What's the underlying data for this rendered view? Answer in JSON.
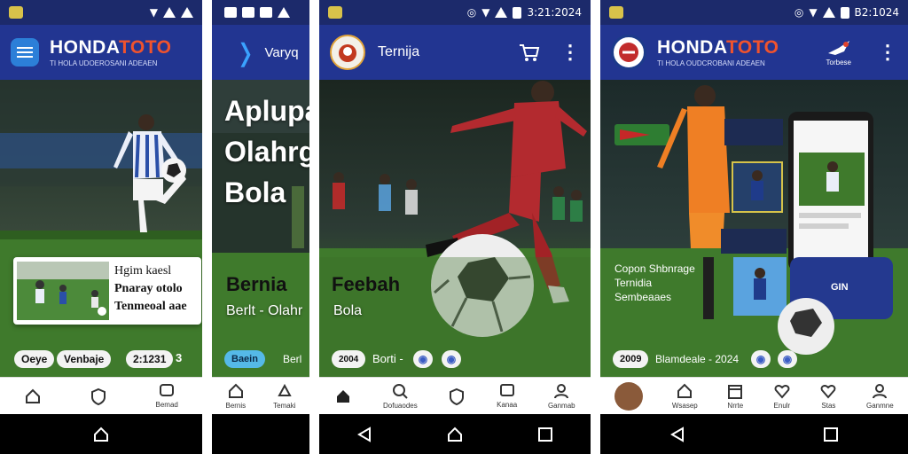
{
  "colors": {
    "appbar": "#223591",
    "statusbar": "#1c2a6b",
    "accent": "#f0532d",
    "pitch": "#3f7a2c"
  },
  "panel1": {
    "brand": "HONDATOTO",
    "brand_accent": "TOTO",
    "brand_main": "HONDA",
    "tagline": "TI HOLA UDOEROSANI ADEAEN",
    "card_lines": [
      "Hgim kaesl",
      "Pnaray otolo",
      "Tenmeoal aae"
    ],
    "chips": [
      "Oeye",
      "Venbaje",
      "2:1231",
      "3"
    ],
    "nav": [
      "",
      "",
      "Bemad"
    ],
    "nav_icons": [
      "home-icon",
      "shield-icon",
      "chat-icon"
    ]
  },
  "panel2": {
    "title": "Varyq",
    "hero_title_lines": [
      "Aplupasi Bernja",
      "Olahrgaga",
      "Bola"
    ],
    "mid_left": "Bernia",
    "mid_right": "Feebah",
    "sub_left": "Berlt - Olahr",
    "sub_right": "Bola",
    "chip_blue": "Baein",
    "chip_text": "Berl",
    "nav": [
      "Bernis",
      "Temaki"
    ]
  },
  "panel3": {
    "title": "Ternija",
    "chip_a": "2004",
    "chip_text": "Borti -",
    "nav": [
      "",
      "Dofuaodes",
      "",
      "Kanaa",
      "Ganmab"
    ]
  },
  "panel4": {
    "brand": "HONDATOTO",
    "brand_main": "HONDA",
    "brand_accent": "TOTO",
    "tagline": "TI HOLA OUDCROBANI ADEAEN",
    "status_time": "B2:1024",
    "right_label": "Torbese",
    "promo_lines": [
      "Copon Shbnrage",
      "Ternidia",
      "Sembeaaes"
    ],
    "chip_a": "2009",
    "chip_text": "Blamdeale - 2024",
    "phone_brand": "GIN",
    "nav": [
      "",
      "Wsasep",
      "Nrrte",
      "Enulr",
      "Stas",
      "Ganmne"
    ]
  },
  "status_times": [
    "",
    "",
    "3:21:2024",
    "B2:1024"
  ]
}
